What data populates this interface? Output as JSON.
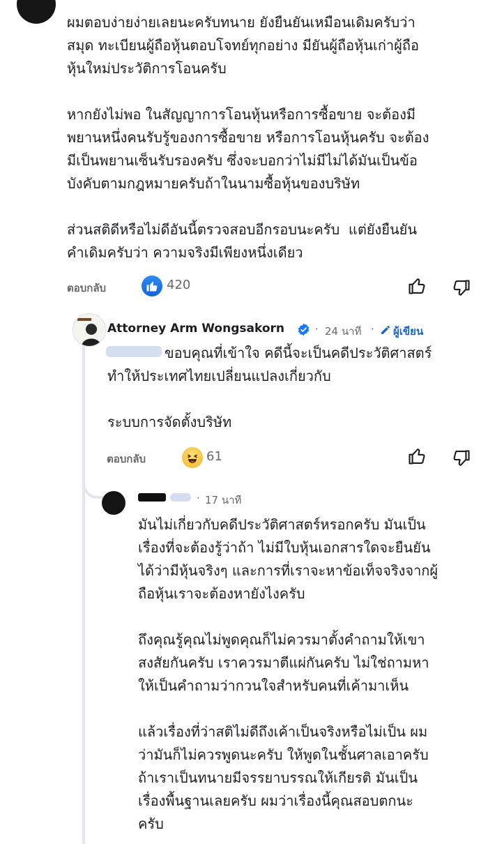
{
  "comments": [
    {
      "text": "ผมตอบง่ายง่ายเลยนะครับทนาย ยังยืนยันเหมือนเดิมครับว่า\nสมุด ทะเบียนผู้ถือหุ้นตอบโจทย์ทุกอย่าง มียันผู้ถือหุ้นเก่าผู้ถือ\nหุ้นใหม่ประวัติการโอนครับ\n\nหากยังไม่พอ ในสัญญาการโอนหุ้นหรือการซื้อขาย จะต้องมี\nพยานหนึ่งคนรับรู้ของการซื้อขาย หรือการโอนหุ้นครับ จะต้อง\nมีเป็นพยานเซ็นรับรองครับ ซึ่งจะบอกว่าไม่มีไม่ได้มันเป็นข้อ\nบังคับตามกฎหมายครับถ้าในนามซื้อหุ้นของบริษัท\n\nส่วนสติดีหรือไม่ดีอันนี้ตรวจสอบอีกรอบนะครับ  แต่ยังยืนยัน\nคำเดิมครับว่า ความจริงมีเพียงหนึ่งเดียว",
      "reply_label": "ตอบกลับ",
      "reaction": "like",
      "reaction_count": "420"
    },
    {
      "author": "Attorney Arm Wongsakorn",
      "time": "24 นาที",
      "author_tag": "ผู้เขียน",
      "text": "ขอบคุณที่เข้าใจ คดีนี้จะเป็นคดีประวัติศาสตร์\nทำให้ประเทศไทยเปลี่ยนแปลงเกี่ยวกับ\n\nระบบการจัดตั้งบริษัท",
      "reply_label": "ตอบกลับ",
      "reaction": "haha",
      "reaction_count": "61"
    },
    {
      "time": "17 นาที",
      "text": "มันไม่เกี่ยวกับคดีประวัติศาสตร์หรอกครับ มันเป็น\nเรื่องที่จะต้องรู้ว่าถ้า ไม่มีใบหุ้นเอกสารใดจะยืนยัน\nได้ว่ามีหุ้นจริงๆ และการที่เราจะหาข้อเท็จจริงจากผู้\nถือหุ้นเราจะต้องหายังไงครับ\n\nถึงคุณรู้คุณไม่พูดคุณก็ไม่ควรมาตั้งคำถามให้เขา\nสงสัยกันครับ เราควรมาตีแผ่กันครับ ไม่ใช่ถามหา\nให้เป็นคำถามว่ากวนใจสำหรับคนที่เค้ามาเห็น\n\nแล้วเรื่องที่ว่าสติไม่ดีถึงเค้าเป็นจริงหรือไม่เป็น ผม\nว่ามันก็ไม่ควรพูดนะครับ ให้พูดในชั้นศาลเอาครับ\nถ้าเราเป็นทนายมีจรรยาบรรณให้เกียรติ มันเป็น\nเรื่องพื้นฐานเลยครับ ผมว่าเรื่องนี้คุณสอบตกนะ\nครับ"
    }
  ],
  "colors": {
    "accent_blue": "#1a65c9",
    "verified_blue": "#1877f2",
    "meta_gray": "#65676b",
    "thread_line": "#e4e6eb"
  },
  "icons": [
    "like-reaction-icon",
    "haha-reaction-icon",
    "thumbs-up-icon",
    "thumbs-down-icon",
    "verified-badge-icon",
    "pencil-icon"
  ]
}
